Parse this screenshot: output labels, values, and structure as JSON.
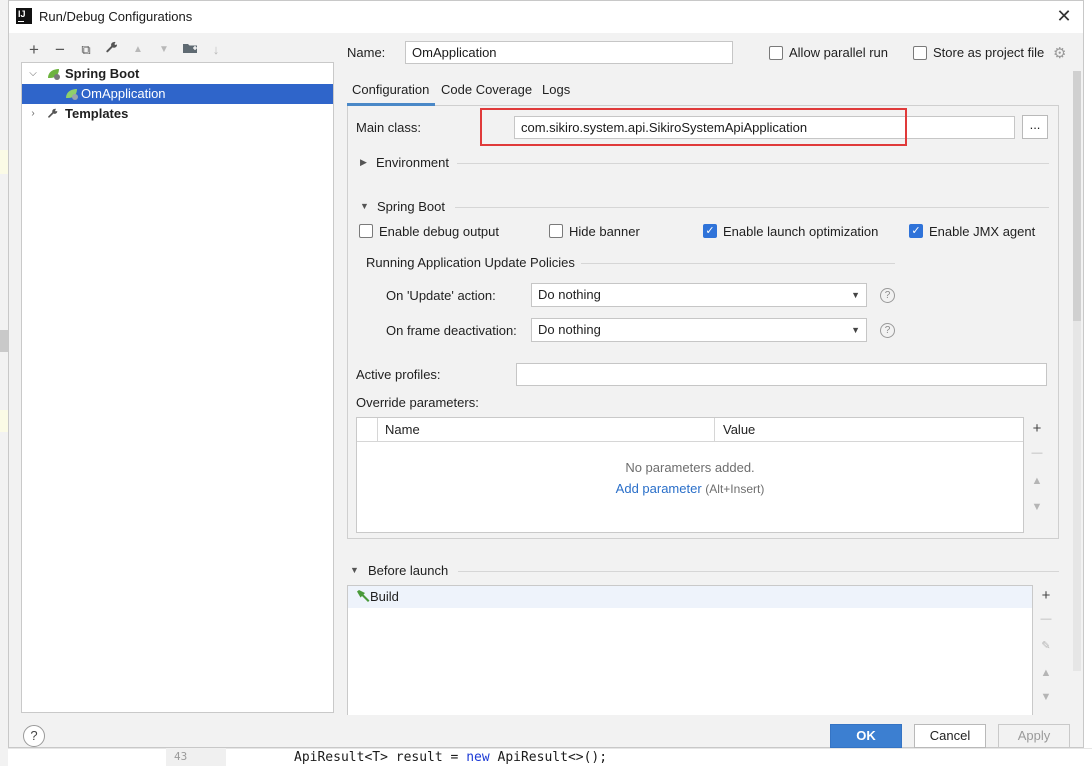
{
  "window": {
    "title": "Run/Debug Configurations"
  },
  "background": {
    "line_number": "43",
    "code_a": "ApiResult<T> result = ",
    "code_kw": "new",
    "code_b": " ApiResult<>();"
  },
  "toolbar": {
    "add": "+",
    "remove": "−",
    "copy": "⧉",
    "edit": "🔧",
    "up": "▲",
    "down": "▼",
    "folder": "📁",
    "sort": "↓"
  },
  "tree": {
    "items": [
      {
        "label": "Spring Boot"
      },
      {
        "label": "OmApplication"
      },
      {
        "label": "Templates"
      }
    ]
  },
  "form": {
    "name_label": "Name:",
    "name_value": "OmApplication",
    "allow_parallel_label": "Allow parallel run",
    "store_project_label": "Store as project file"
  },
  "tabs": [
    "Configuration",
    "Code Coverage",
    "Logs"
  ],
  "config": {
    "main_class_label": "Main class:",
    "main_class_value": "com.sikiro.system.api.SikiroSystemApiApplication",
    "browse_label": "...",
    "environment_label": "Environment",
    "spring_boot_label": "Spring Boot",
    "enable_debug_label": "Enable debug output",
    "hide_banner_label": "Hide banner",
    "enable_launch_label": "Enable launch optimization",
    "enable_jmx_label": "Enable JMX agent",
    "policies_label": "Running Application Update Policies",
    "on_update_label": "On 'Update' action:",
    "on_update_value": "Do nothing",
    "on_frame_label": "On frame deactivation:",
    "on_frame_value": "Do nothing",
    "active_profiles_label": "Active profiles:",
    "active_profiles_value": "",
    "override_label": "Override parameters:",
    "col_name": "Name",
    "col_value": "Value",
    "empty_text": "No parameters added.",
    "add_param_link": "Add parameter",
    "add_param_shortcut": "(Alt+Insert)"
  },
  "before_launch": {
    "label": "Before launch",
    "items": [
      {
        "label": "Build"
      }
    ]
  },
  "buttons": {
    "help": "?",
    "ok": "OK",
    "cancel": "Cancel",
    "apply": "Apply"
  },
  "checkbox_state": {
    "allow_parallel": false,
    "store_project": false,
    "enable_debug": false,
    "hide_banner": false,
    "enable_launch": true,
    "enable_jmx": true
  },
  "colors": {
    "selection": "#2f65ca",
    "highlight_box": "#e03a3a",
    "ok_button": "#3c7fd1",
    "link": "#2a6fc9",
    "checkbox_on": "#2f73d9"
  }
}
